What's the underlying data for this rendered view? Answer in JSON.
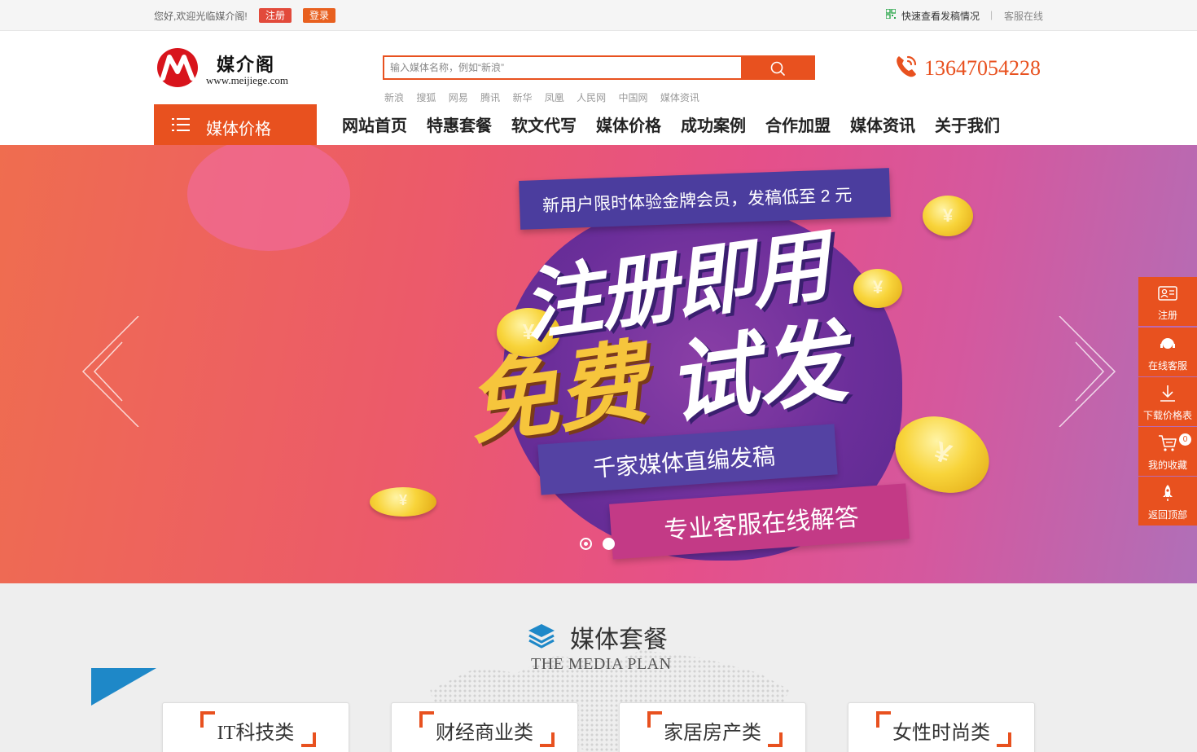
{
  "topbar": {
    "welcome": "您好,欢迎光临媒介阁!",
    "register": "注册",
    "login": "登录",
    "quick_check": "快速查看发稿情况",
    "separator": "|",
    "service_online": "客服在线"
  },
  "header": {
    "logo_name": "媒介阁",
    "logo_url": "www.meijiege.com",
    "search_placeholder": "输入媒体名称，例如“新浪”",
    "hot_words": [
      "新浪",
      "搜狐",
      "网易",
      "腾讯",
      "新华",
      "凤凰",
      "人民网",
      "中国网",
      "媒体资讯"
    ],
    "phone": "13647054228"
  },
  "nav": {
    "category_label": "媒体价格",
    "items": [
      "网站首页",
      "特惠套餐",
      "软文代写",
      "媒体价格",
      "成功案例",
      "合作加盟",
      "媒体资讯",
      "关于我们"
    ]
  },
  "banner": {
    "ribbon": "新用户限时体验金牌会员，发稿低至 2 元",
    "headline1": "注册即用",
    "headline2a": "免费",
    "headline2b": "试发",
    "line1": "千家媒体直编发稿",
    "line2": "专业客服在线解答",
    "slide_count": 2,
    "active_slide": 1
  },
  "section": {
    "title": "媒体套餐",
    "subtitle": "THE MEDIA PLAN",
    "cards": [
      "IT科技类",
      "财经商业类",
      "家居房产类",
      "女性时尚类"
    ]
  },
  "sidebar": {
    "items": [
      {
        "label": "注册",
        "icon": "id-card-icon"
      },
      {
        "label": "在线客服",
        "icon": "headset-icon"
      },
      {
        "label": "下载价格表",
        "icon": "download-icon"
      },
      {
        "label": "我的收藏",
        "icon": "cart-icon",
        "badge": "0"
      },
      {
        "label": "返回顶部",
        "icon": "rocket-icon"
      }
    ]
  },
  "colors": {
    "brand": "#e8511f",
    "register_red": "#e24a3b"
  }
}
